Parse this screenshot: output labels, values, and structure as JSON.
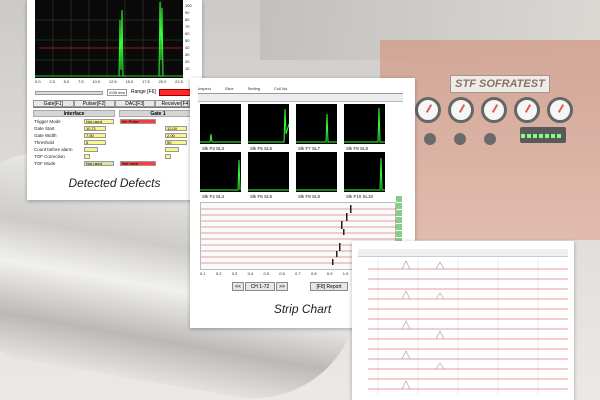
{
  "card1": {
    "caption": "Detected Defects",
    "scope_ticks": [
      "0.0",
      "2.5",
      "5.0",
      "7.5",
      "10.0",
      "12.5",
      "15.0",
      "17.5",
      "20.0",
      "22.5"
    ],
    "y_ticks": [
      "100",
      "90",
      "80",
      "70",
      "60",
      "50",
      "40",
      "30",
      "20",
      "10",
      "0"
    ],
    "range_label": "Range [F6]",
    "range_value": "0.00 mm",
    "tabs": [
      "Gate[F1]",
      "Pulser[F2]",
      "DAC[F3]",
      "Receiver[F4]"
    ],
    "interface_title": "Interface",
    "gate_title": "Gate 1",
    "left_rows": [
      {
        "label": "Trigger Mode",
        "value": "Not used"
      },
      {
        "label": "Gate Start",
        "value": "10.71"
      },
      {
        "label": "Gate Width",
        "value": "7.50"
      },
      {
        "label": "Threshold",
        "value": "5"
      },
      {
        "label": "Count before alarm",
        "value": ""
      },
      {
        "label": "TOF Correction",
        "value": ""
      },
      {
        "label": "TOF Mode",
        "value": "Not used"
      }
    ],
    "right_rows": [
      {
        "value": "Int. Pulse"
      },
      {
        "value": "12.00"
      },
      {
        "value": "2.00"
      },
      {
        "value": "50"
      },
      {
        "value": ""
      },
      {
        "value": ""
      },
      {
        "value": "Not used"
      }
    ]
  },
  "card2": {
    "caption": "Strip Chart",
    "header": [
      "Inspect",
      "Slice",
      "Setting",
      "Coil No."
    ],
    "tiles_top": [
      "Slk F3 SL3",
      "Slk F5 SL5",
      "Slk F7 SL7",
      "Slk F8 SL8"
    ],
    "tiles_bottom": [
      "Slk F4 SL4",
      "Slk F6 SL6",
      "Slk F8 SL8",
      "Slk F10 SL10"
    ],
    "x_ticks": [
      "0.1",
      "0.2",
      "0.3",
      "0.4",
      "0.5",
      "0.6",
      "0.7",
      "0.8",
      "0.9",
      "1.0",
      "1.1",
      "1.2",
      "1.3"
    ],
    "nav_label": "CH 1-72",
    "report_label": "[F8] Report"
  },
  "card3": {
    "row_count": "14"
  },
  "machine": {
    "logo": "STF SOFRATEST"
  }
}
